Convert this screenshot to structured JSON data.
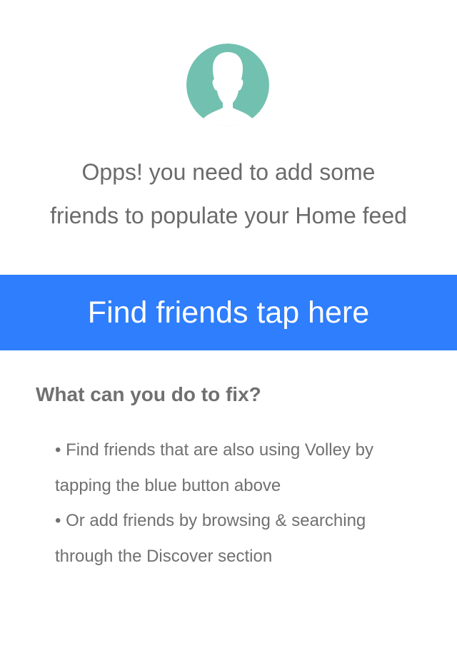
{
  "avatar": {
    "icon": "user-silhouette-icon",
    "background_color": "#72c1b0",
    "figure_color": "#ffffff"
  },
  "message": {
    "line1": "Opps! you need to add some",
    "line2": "friends to populate your Home feed"
  },
  "find_button": {
    "label": "Find friends tap here",
    "color": "#2e7efd"
  },
  "help": {
    "title": "What can you do to fix?",
    "tips": [
      {
        "line1": "• Find friends that are also using Volley by",
        "line2": "tapping the blue button above"
      },
      {
        "line1": "• Or add friends by browsing & searching",
        "line2": "through the Discover section"
      }
    ]
  }
}
